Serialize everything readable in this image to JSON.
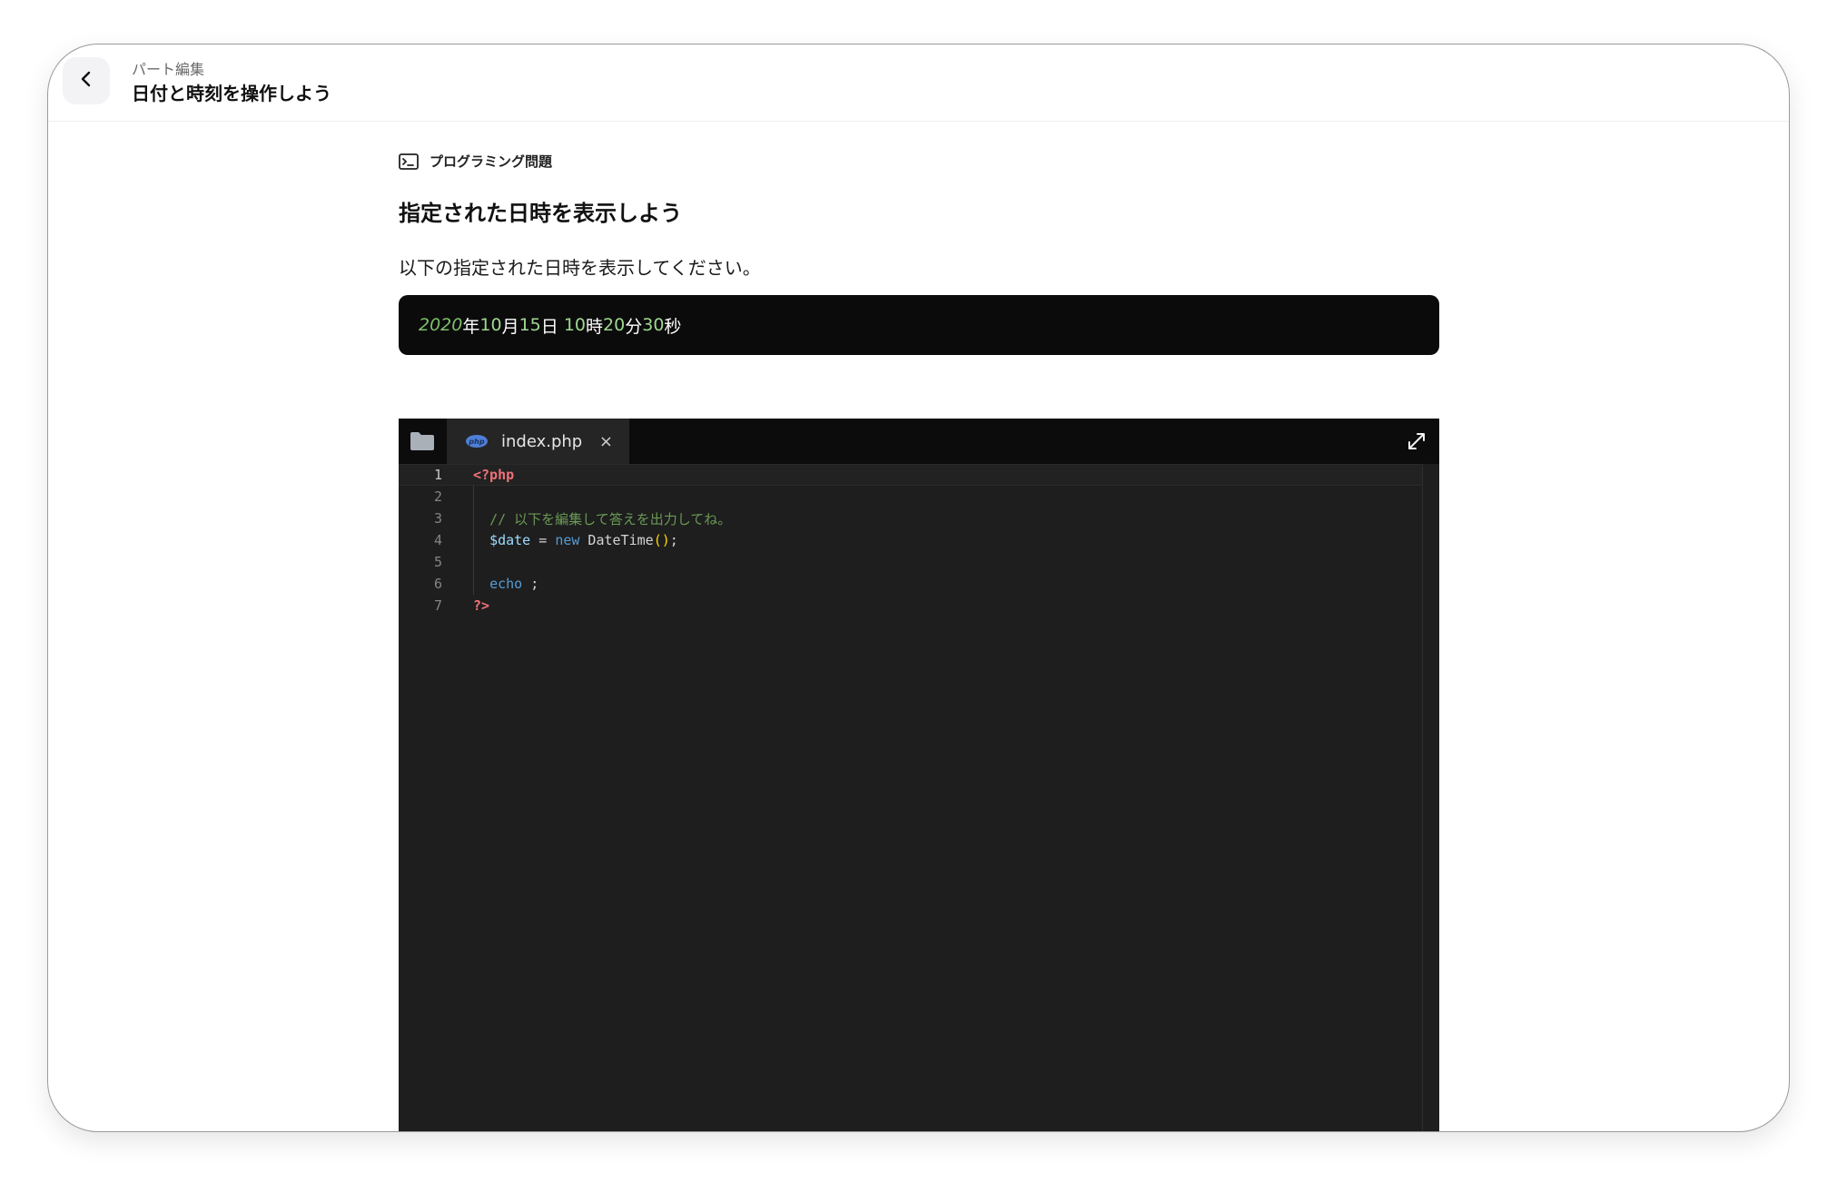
{
  "header": {
    "breadcrumb": "パート編集",
    "title": "日付と時刻を操作しよう"
  },
  "question": {
    "type_label": "プログラミング問題",
    "title": "指定された日時を表示しよう",
    "description": "以下の指定された日時を表示してください。"
  },
  "expected_output": {
    "year": "2020",
    "year_unit": "年",
    "month": "10",
    "month_unit": "月",
    "day": "15",
    "day_unit": "日",
    "hour": "10",
    "hour_unit": "時",
    "minute": "20",
    "minute_unit": "分",
    "second": "30",
    "second_unit": "秒"
  },
  "editor": {
    "tab_filename": "index.php",
    "tab_close": "×",
    "lines": [
      {
        "n": "1",
        "open_tag": "<?php"
      },
      {
        "n": "2"
      },
      {
        "n": "3",
        "comment": "// 以下を編集して答えを出力してね。"
      },
      {
        "n": "4",
        "var": "$date",
        "eq": " = ",
        "kw": "new",
        "cls": " DateTime",
        "paren": "()",
        "semi": ";"
      },
      {
        "n": "5"
      },
      {
        "n": "6",
        "kw": "echo",
        "rest": " ;"
      },
      {
        "n": "7",
        "close_tag": "?>"
      }
    ]
  },
  "icons": {
    "back": "chevron-left-icon",
    "terminal": "terminal-icon",
    "folder": "folder-icon",
    "php": "php-file-icon",
    "expand": "expand-icon"
  },
  "colors": {
    "editor_bg": "#1e1e1e",
    "tabbar_bg": "#0c0c0d",
    "output_bg": "#0b0b0c",
    "number_green": "#9fd88f",
    "php_tag": "#f07178"
  }
}
